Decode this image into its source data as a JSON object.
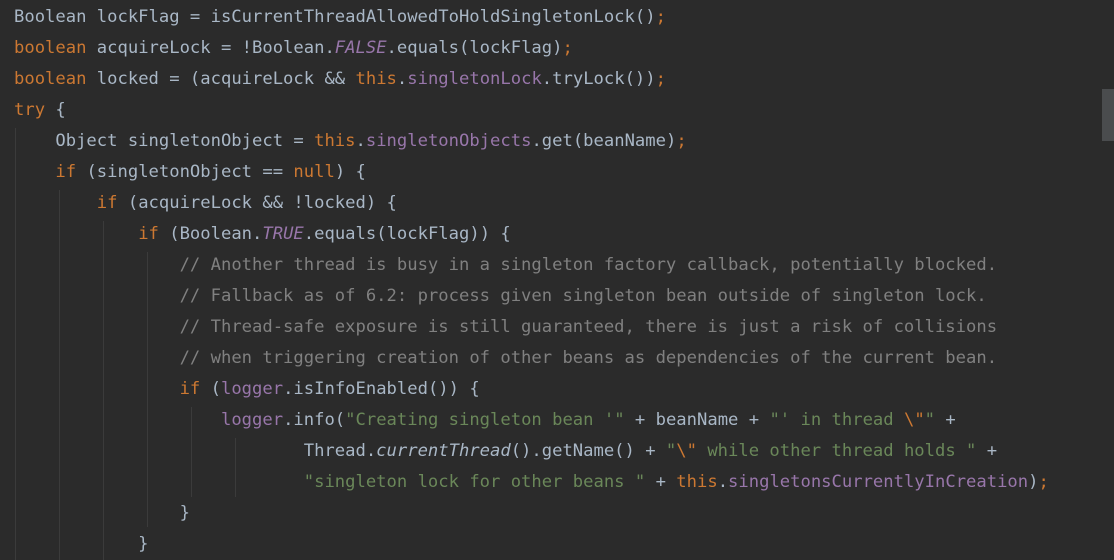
{
  "editor": {
    "lines": [
      {
        "tokens": [
          {
            "t": "Boolean lockFlag = isCurrentThreadAllowedToHoldSingletonLock()",
            "c": ""
          },
          {
            "t": ";",
            "c": "kw"
          }
        ]
      },
      {
        "tokens": [
          {
            "t": "boolean ",
            "c": "kw"
          },
          {
            "t": "acquireLock = !Boolean.",
            "c": ""
          },
          {
            "t": "FALSE",
            "c": "field-i"
          },
          {
            "t": ".equals(lockFlag)",
            "c": ""
          },
          {
            "t": ";",
            "c": "kw"
          }
        ]
      },
      {
        "tokens": [
          {
            "t": "boolean ",
            "c": "kw"
          },
          {
            "t": "locked = (acquireLock && ",
            "c": ""
          },
          {
            "t": "this",
            "c": "kw"
          },
          {
            "t": ".",
            "c": ""
          },
          {
            "t": "singletonLock",
            "c": "field"
          },
          {
            "t": ".tryLock())",
            "c": ""
          },
          {
            "t": ";",
            "c": "kw"
          }
        ]
      },
      {
        "tokens": [
          {
            "t": "try ",
            "c": "kw"
          },
          {
            "t": "{",
            "c": ""
          }
        ]
      },
      {
        "tokens": [
          {
            "t": "    Object singletonObject = ",
            "c": ""
          },
          {
            "t": "this",
            "c": "kw"
          },
          {
            "t": ".",
            "c": ""
          },
          {
            "t": "singletonObjects",
            "c": "field"
          },
          {
            "t": ".get(beanName)",
            "c": ""
          },
          {
            "t": ";",
            "c": "kw"
          }
        ]
      },
      {
        "tokens": [
          {
            "t": "    ",
            "c": ""
          },
          {
            "t": "if ",
            "c": "kw"
          },
          {
            "t": "(singletonObject == ",
            "c": ""
          },
          {
            "t": "null",
            "c": "kw"
          },
          {
            "t": ") {",
            "c": ""
          }
        ]
      },
      {
        "tokens": [
          {
            "t": "        ",
            "c": ""
          },
          {
            "t": "if ",
            "c": "kw"
          },
          {
            "t": "(acquireLock && !locked) {",
            "c": ""
          }
        ]
      },
      {
        "tokens": [
          {
            "t": "            ",
            "c": ""
          },
          {
            "t": "if ",
            "c": "kw"
          },
          {
            "t": "(Boolean.",
            "c": ""
          },
          {
            "t": "TRUE",
            "c": "field-i"
          },
          {
            "t": ".equals(lockFlag)) {",
            "c": ""
          }
        ]
      },
      {
        "tokens": [
          {
            "t": "                ",
            "c": ""
          },
          {
            "t": "// Another thread is busy in a singleton factory callback, potentially blocked.",
            "c": "cmt"
          }
        ]
      },
      {
        "tokens": [
          {
            "t": "                ",
            "c": ""
          },
          {
            "t": "// Fallback as of 6.2: process given singleton bean outside of singleton lock.",
            "c": "cmt"
          }
        ]
      },
      {
        "tokens": [
          {
            "t": "                ",
            "c": ""
          },
          {
            "t": "// Thread-safe exposure is still guaranteed, there is just a risk of collisions",
            "c": "cmt"
          }
        ]
      },
      {
        "tokens": [
          {
            "t": "                ",
            "c": ""
          },
          {
            "t": "// when triggering creation of other beans as dependencies of the current bean.",
            "c": "cmt"
          }
        ]
      },
      {
        "tokens": [
          {
            "t": "                ",
            "c": ""
          },
          {
            "t": "if ",
            "c": "kw"
          },
          {
            "t": "(",
            "c": ""
          },
          {
            "t": "logger",
            "c": "field"
          },
          {
            "t": ".isInfoEnabled()) {",
            "c": ""
          }
        ]
      },
      {
        "tokens": [
          {
            "t": "                    ",
            "c": ""
          },
          {
            "t": "logger",
            "c": "field"
          },
          {
            "t": ".info(",
            "c": ""
          },
          {
            "t": "\"Creating singleton bean '\" ",
            "c": "str"
          },
          {
            "t": "+ beanName + ",
            "c": ""
          },
          {
            "t": "\"' in thread ",
            "c": "str"
          },
          {
            "t": "\\\"",
            "c": "kw"
          },
          {
            "t": "\" ",
            "c": "str"
          },
          {
            "t": "+",
            "c": ""
          }
        ]
      },
      {
        "tokens": [
          {
            "t": "                            Thread.",
            "c": ""
          },
          {
            "t": "currentThread",
            "c": "static-i"
          },
          {
            "t": "().getName() + ",
            "c": ""
          },
          {
            "t": "\"",
            "c": "str"
          },
          {
            "t": "\\\"",
            "c": "kw"
          },
          {
            "t": " while other thread holds \" ",
            "c": "str"
          },
          {
            "t": "+",
            "c": ""
          }
        ]
      },
      {
        "tokens": [
          {
            "t": "                            ",
            "c": ""
          },
          {
            "t": "\"singleton lock for other beans \" ",
            "c": "str"
          },
          {
            "t": "+ ",
            "c": ""
          },
          {
            "t": "this",
            "c": "kw"
          },
          {
            "t": ".",
            "c": ""
          },
          {
            "t": "singletonsCurrentlyInCreation",
            "c": "field"
          },
          {
            "t": ")",
            "c": ""
          },
          {
            "t": ";",
            "c": "kw"
          }
        ]
      },
      {
        "tokens": [
          {
            "t": "                }",
            "c": ""
          }
        ]
      },
      {
        "tokens": [
          {
            "t": "            }",
            "c": ""
          }
        ]
      }
    ]
  },
  "colors": {
    "background": "#2b2b2b",
    "default_text": "#a9b7c6",
    "keyword": "#cc7832",
    "field": "#9876aa",
    "string": "#6a8759",
    "comment": "#808080"
  }
}
